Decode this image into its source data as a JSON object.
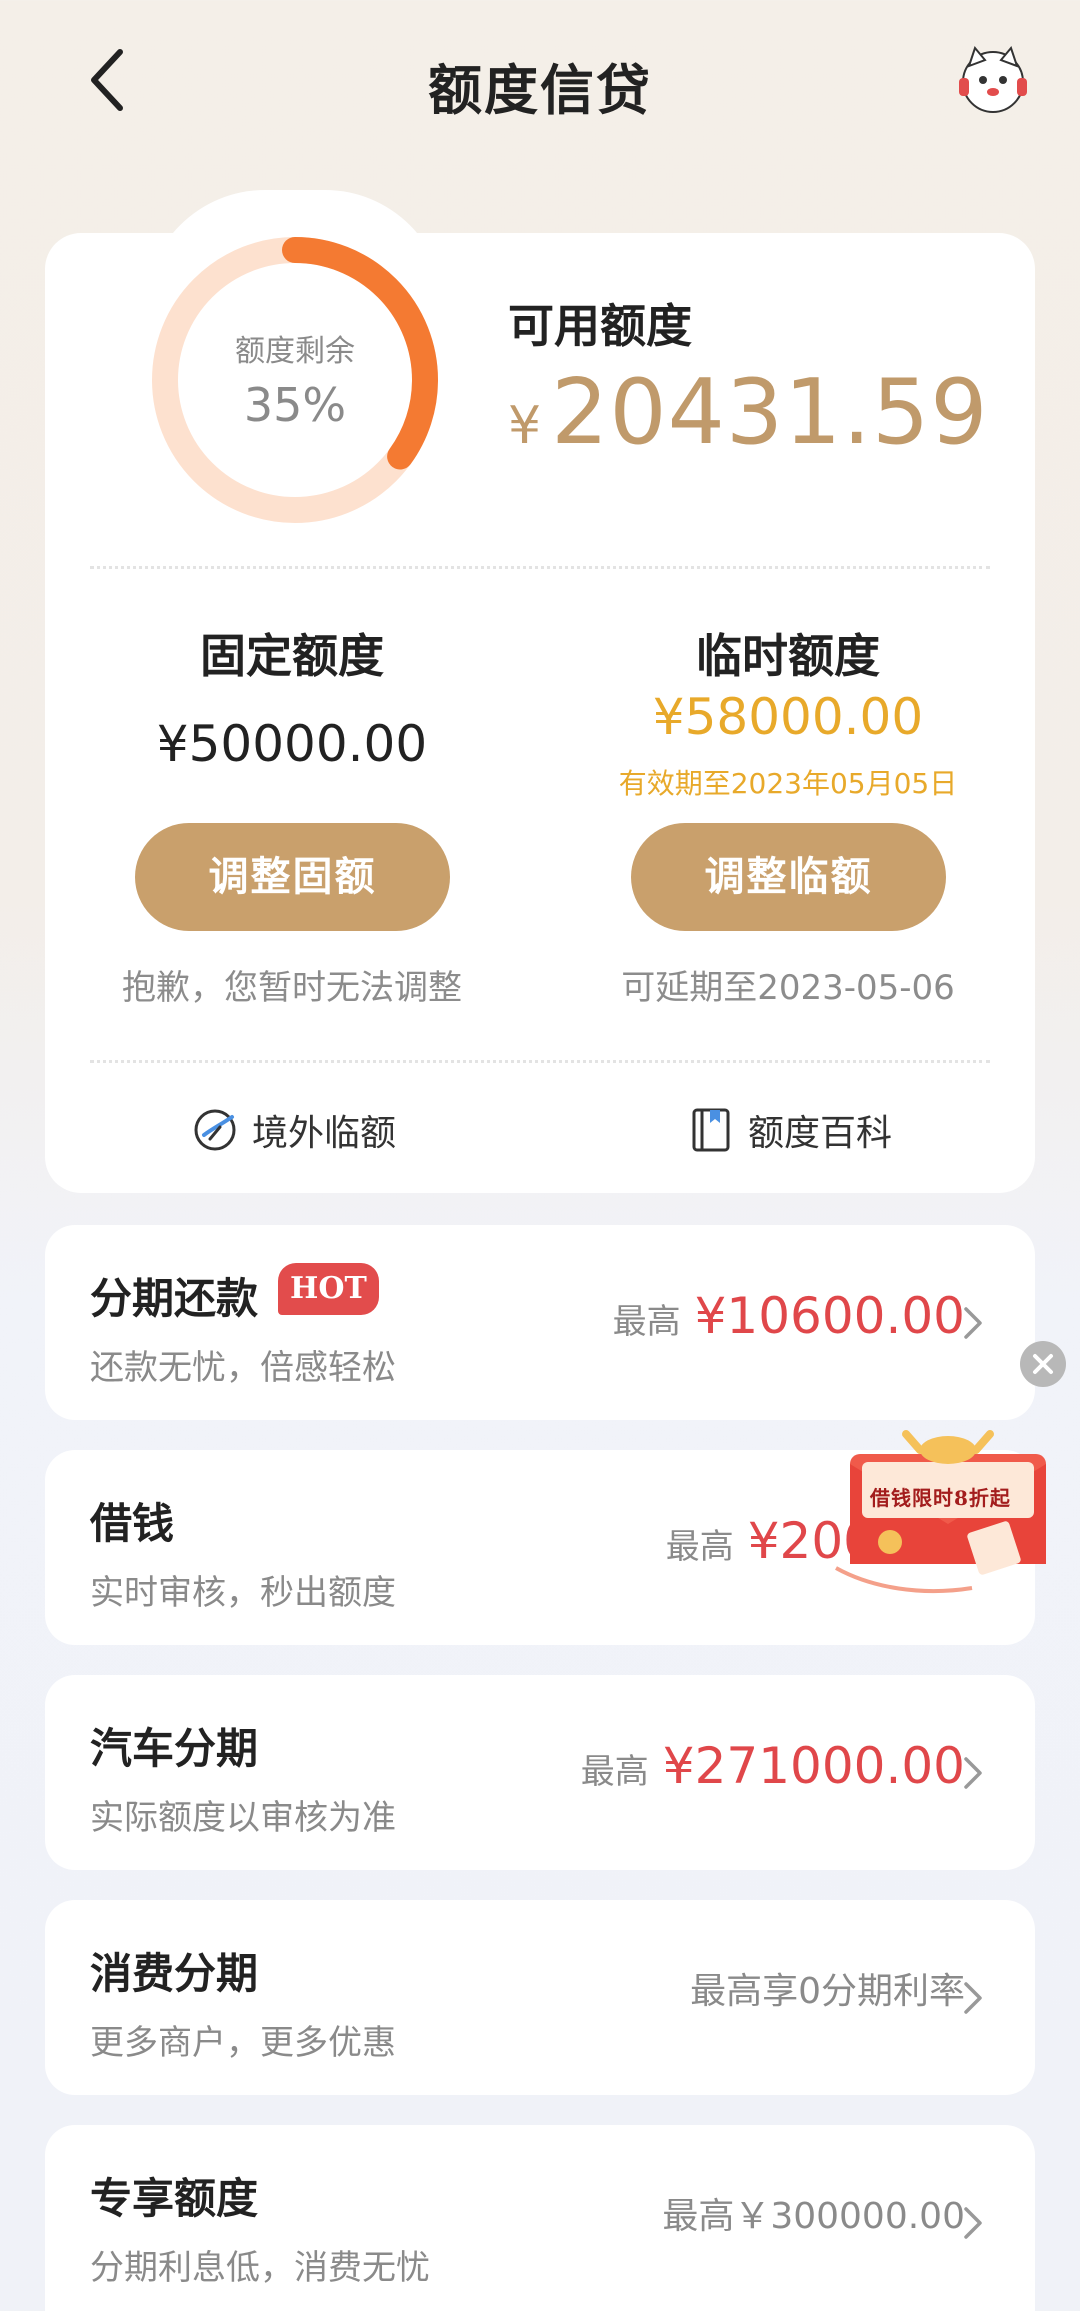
{
  "header": {
    "title": "额度信贷"
  },
  "ring": {
    "label": "额度剩余",
    "value": "35%",
    "percent": 35,
    "track_color": "#fde1cf",
    "fill_color": "#f47a32"
  },
  "available": {
    "label": "可用额度",
    "currency": "¥",
    "amount": "20431.59"
  },
  "fixed": {
    "title": "固定额度",
    "value": "¥50000.00",
    "button": "调整固额",
    "note": "抱歉，您暂时无法调整"
  },
  "temp": {
    "title": "临时额度",
    "value": "¥58000.00",
    "valid": "有效期至2023年05月05日",
    "button": "调整临额",
    "note": "可延期至2023-05-06"
  },
  "links": {
    "overseas": "境外临额",
    "overseas_icon": "compass-icon",
    "wiki": "额度百科",
    "wiki_icon": "book-icon"
  },
  "list": [
    {
      "title": "分期还款",
      "badge": "HOT",
      "subtitle": "还款无忧，倍感轻松",
      "prefix": "最高",
      "amount": "¥10600.00"
    },
    {
      "title": "借钱",
      "subtitle": "实时审核，秒出额度",
      "prefix": "最高",
      "amount": "¥200"
    },
    {
      "title": "汽车分期",
      "subtitle": "实际额度以审核为准",
      "prefix": "最高",
      "amount": "¥271000.00"
    },
    {
      "title": "消费分期",
      "subtitle": "更多商户，更多优惠",
      "prefix": "",
      "amount": "最高享0分期利率"
    },
    {
      "title": "专享额度",
      "subtitle": "分期利息低，消费无忧",
      "prefix": "",
      "amount": "最高￥300000.00"
    }
  ],
  "promo": {
    "text": "借钱限时8折起"
  },
  "colors": {
    "gold": "#c9a06c",
    "gold_text": "#c09a6b",
    "orange_text": "#e8a92a",
    "red_amount": "#e0474a"
  }
}
